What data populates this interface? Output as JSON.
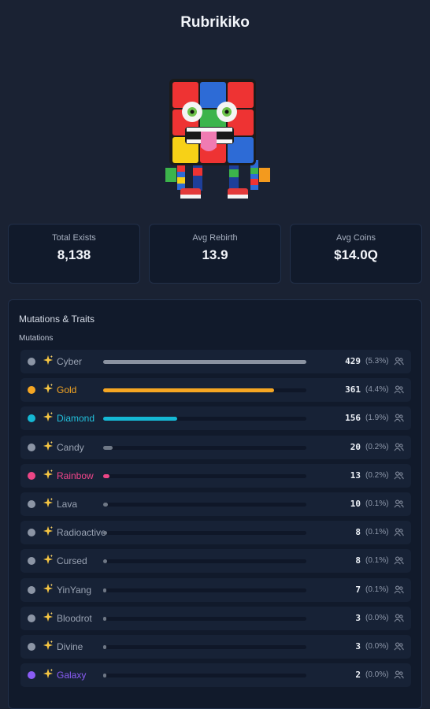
{
  "title": "Rubrikiko",
  "stats": [
    {
      "label": "Total Exists",
      "value": "8,138"
    },
    {
      "label": "Avg Rebirth",
      "value": "13.9"
    },
    {
      "label": "Avg Coins",
      "value": "$14.0Q"
    }
  ],
  "panel": {
    "title": "Mutations & Traits",
    "section": "Mutations",
    "rows": [
      {
        "name": "Cyber",
        "count": "429",
        "pct": "(5.3%)",
        "share": 1.0,
        "color": "#9aa3b3",
        "bar": "#8b93a1",
        "dot": "#8c95a5"
      },
      {
        "name": "Gold",
        "count": "361",
        "pct": "(4.4%)",
        "share": 0.84,
        "color": "#f5a623",
        "bar": "#f5a623",
        "dot": "#f5a623"
      },
      {
        "name": "Diamond",
        "count": "156",
        "pct": "(1.9%)",
        "share": 0.364,
        "color": "#22c1dc",
        "bar": "#15b8d4",
        "dot": "#15b8d4"
      },
      {
        "name": "Candy",
        "count": "20",
        "pct": "(0.2%)",
        "share": 0.047,
        "color": "#9aa3b3",
        "bar": "#6f7886",
        "dot": "#8c95a5"
      },
      {
        "name": "Rainbow",
        "count": "13",
        "pct": "(0.2%)",
        "share": 0.03,
        "color": "#f0458a",
        "bar": "#ec4686",
        "dot": "#ec4686"
      },
      {
        "name": "Lava",
        "count": "10",
        "pct": "(0.1%)",
        "share": 0.023,
        "color": "#9aa3b3",
        "bar": "#6f7886",
        "dot": "#8c95a5"
      },
      {
        "name": "Radioactive",
        "count": "8",
        "pct": "(0.1%)",
        "share": 0.019,
        "color": "#9aa3b3",
        "bar": "#6f7886",
        "dot": "#8c95a5"
      },
      {
        "name": "Cursed",
        "count": "8",
        "pct": "(0.1%)",
        "share": 0.019,
        "color": "#9aa3b3",
        "bar": "#6f7886",
        "dot": "#8c95a5"
      },
      {
        "name": "YinYang",
        "count": "7",
        "pct": "(0.1%)",
        "share": 0.016,
        "color": "#9aa3b3",
        "bar": "#6f7886",
        "dot": "#8c95a5"
      },
      {
        "name": "Bloodrot",
        "count": "3",
        "pct": "(0.0%)",
        "share": 0.007,
        "color": "#9aa3b3",
        "bar": "#6f7886",
        "dot": "#8c95a5"
      },
      {
        "name": "Divine",
        "count": "3",
        "pct": "(0.0%)",
        "share": 0.007,
        "color": "#9aa3b3",
        "bar": "#6f7886",
        "dot": "#8c95a5"
      },
      {
        "name": "Galaxy",
        "count": "2",
        "pct": "(0.0%)",
        "share": 0.005,
        "color": "#8b5cf6",
        "bar": "#6f7886",
        "dot": "#8b5cf6"
      }
    ]
  },
  "icons": {
    "sparkle": "sparkle-icon",
    "users": "users-icon"
  }
}
